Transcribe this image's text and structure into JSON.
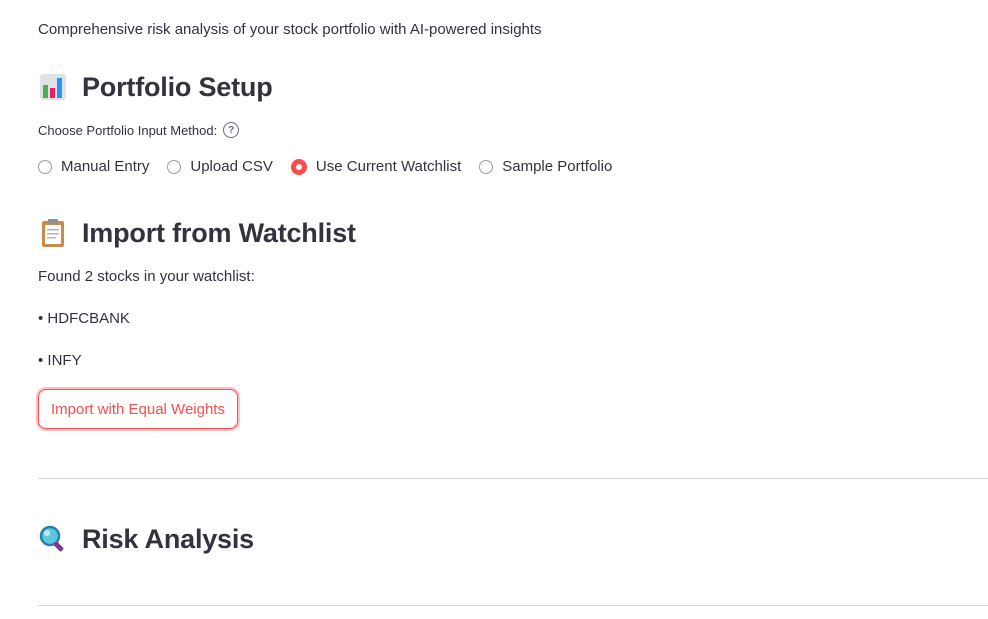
{
  "subtitle": "Comprehensive risk analysis of your stock portfolio with AI-powered insights",
  "sections": {
    "setup": {
      "icon": "bar-chart-icon",
      "title": "Portfolio Setup"
    },
    "import": {
      "icon": "clipboard-icon",
      "title": "Import from Watchlist"
    },
    "risk": {
      "icon": "magnifier-icon",
      "title": "Risk Analysis"
    }
  },
  "input_method": {
    "label": "Choose Portfolio Input Method:",
    "help_icon": "question-icon",
    "options": [
      {
        "label": "Manual Entry",
        "selected": false
      },
      {
        "label": "Upload CSV",
        "selected": false
      },
      {
        "label": "Use Current Watchlist",
        "selected": true
      },
      {
        "label": "Sample Portfolio",
        "selected": false
      }
    ]
  },
  "watchlist": {
    "found_text": "Found 2 stocks in your watchlist:",
    "stocks": [
      "• HDFCBANK",
      "• INFY"
    ],
    "import_button": "Import with Equal Weights"
  },
  "colors": {
    "accent": "#ff4b4b",
    "text": "#31333f",
    "divider": "#d6d6d9"
  }
}
